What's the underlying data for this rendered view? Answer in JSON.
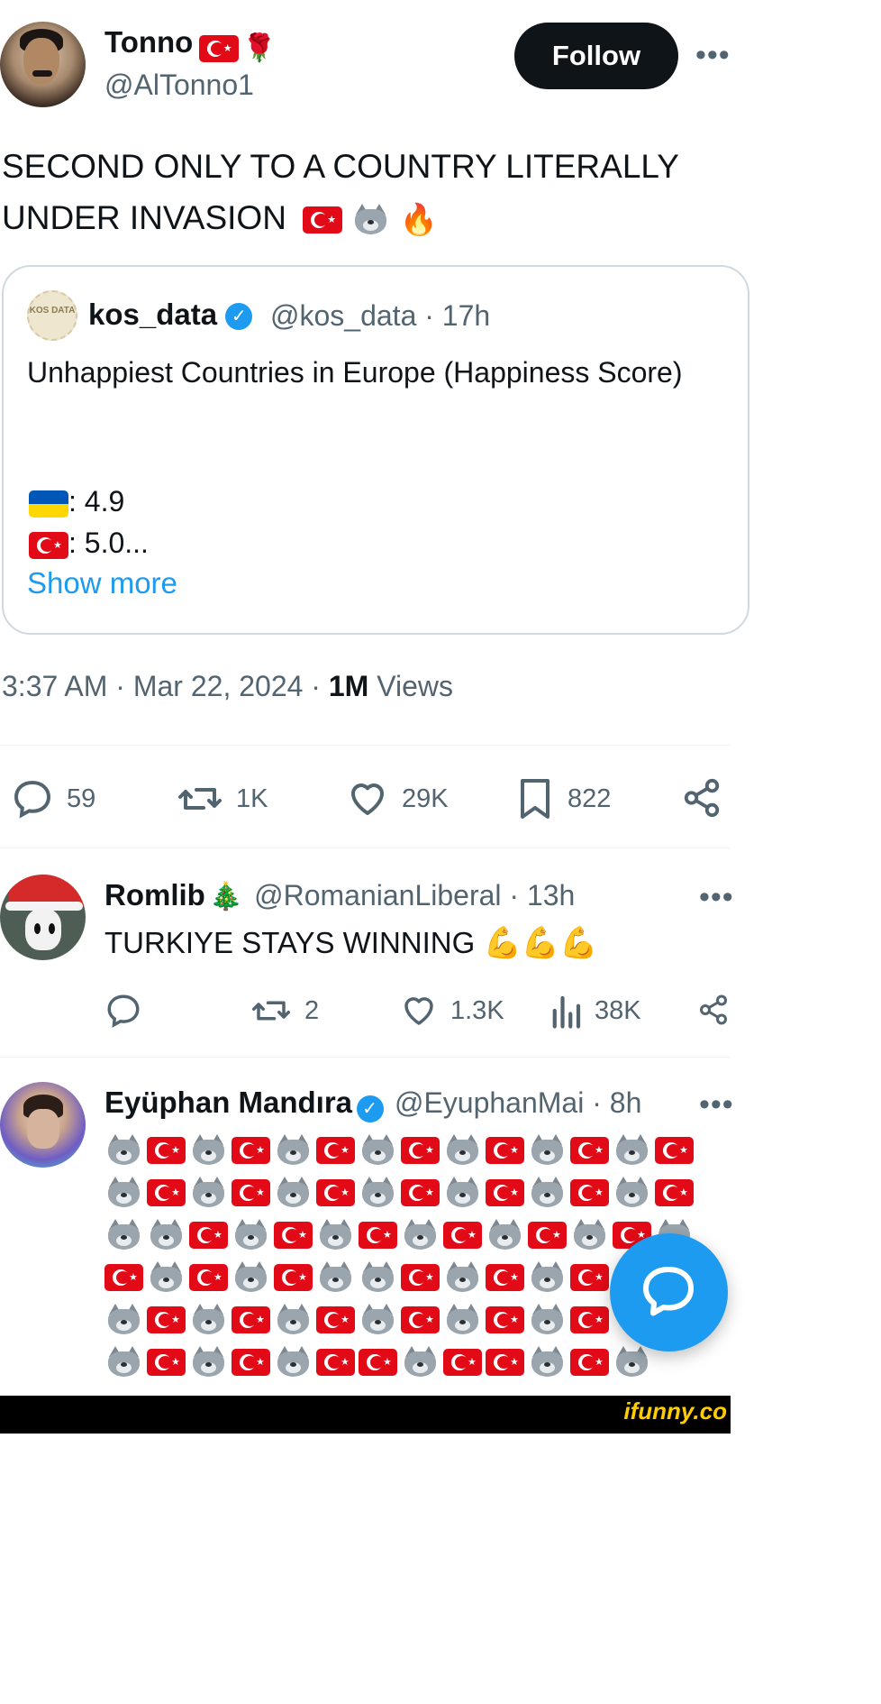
{
  "main_tweet": {
    "display_name": "Tonno",
    "handle": "@AlTonno1",
    "follow_label": "Follow",
    "more_label": "•••",
    "text_line1": "SECOND ONLY TO A COUNTRY LITERALLY",
    "text_line2": "UNDER INVASION",
    "name_emoji": [
      "turkey-flag",
      "rose"
    ],
    "text_emoji": [
      "turkey-flag",
      "wolf",
      "fire"
    ]
  },
  "quote": {
    "display_name": "kos_data",
    "avatar_text": "KOS DATA",
    "handle_time": "@kos_data · 17h",
    "text": "Unhappiest Countries in Europe (Happiness Score)",
    "rows": [
      {
        "flag": "ukraine-flag",
        "value": ": 4.9"
      },
      {
        "flag": "turkey-flag",
        "value": ": 5.0..."
      }
    ],
    "show_more": "Show more"
  },
  "meta": {
    "time_date": "3:37 AM · Mar 22, 2024 · ",
    "views_count": "1M",
    "views_label": " Views"
  },
  "actions": {
    "replies": "59",
    "reposts": "1K",
    "likes": "29K",
    "bookmarks": "822"
  },
  "reply1": {
    "display_name": "Romlib",
    "handle_time": "@RomanianLiberal · 13h",
    "text": "TURKIYE STAYS WINNING",
    "more_label": "•••",
    "name_emoji": "christmas-tree",
    "text_emoji": [
      "flexed-biceps",
      "flexed-biceps",
      "flexed-biceps"
    ],
    "reposts": "2",
    "likes": "1.3K",
    "views": "38K"
  },
  "reply2": {
    "display_name": "Eyüphan Mandıra",
    "handle_time": "@EyuphanMai · 8h",
    "more_label": "•••",
    "emoji_rows": [
      [
        "wolf",
        "flag",
        "wolf",
        "flag",
        "wolf",
        "flag",
        "wolf",
        "flag",
        "wolf",
        "flag",
        "wolf",
        "flag",
        "wolf",
        "flag"
      ],
      [
        "wolf",
        "flag",
        "wolf",
        "flag",
        "wolf",
        "flag",
        "wolf",
        "flag",
        "wolf",
        "flag",
        "wolf",
        "flag",
        "wolf",
        "flag"
      ],
      [
        "wolf",
        "wolf",
        "flag",
        "wolf",
        "flag",
        "wolf",
        "flag",
        "wolf",
        "flag",
        "wolf",
        "flag",
        "wolf",
        "flag",
        "wolf"
      ],
      [
        "flag",
        "wolf",
        "flag",
        "wolf",
        "flag",
        "wolf",
        "wolf",
        "flag",
        "wolf",
        "flag",
        "wolf",
        "flag"
      ],
      [
        "wolf",
        "flag",
        "wolf",
        "flag",
        "wolf",
        "flag",
        "wolf",
        "flag",
        "wolf",
        "flag",
        "wolf",
        "flag"
      ],
      [
        "wolf",
        "flag",
        "wolf",
        "flag",
        "wolf",
        "flag",
        "flag",
        "wolf",
        "flag",
        "flag",
        "wolf",
        "flag",
        "wolf"
      ]
    ]
  },
  "watermark": "ifunny.co",
  "colors": {
    "accent": "#1d9bf0",
    "text": "#0f1419",
    "secondary": "#536471",
    "turkey_red": "#e30a17"
  }
}
